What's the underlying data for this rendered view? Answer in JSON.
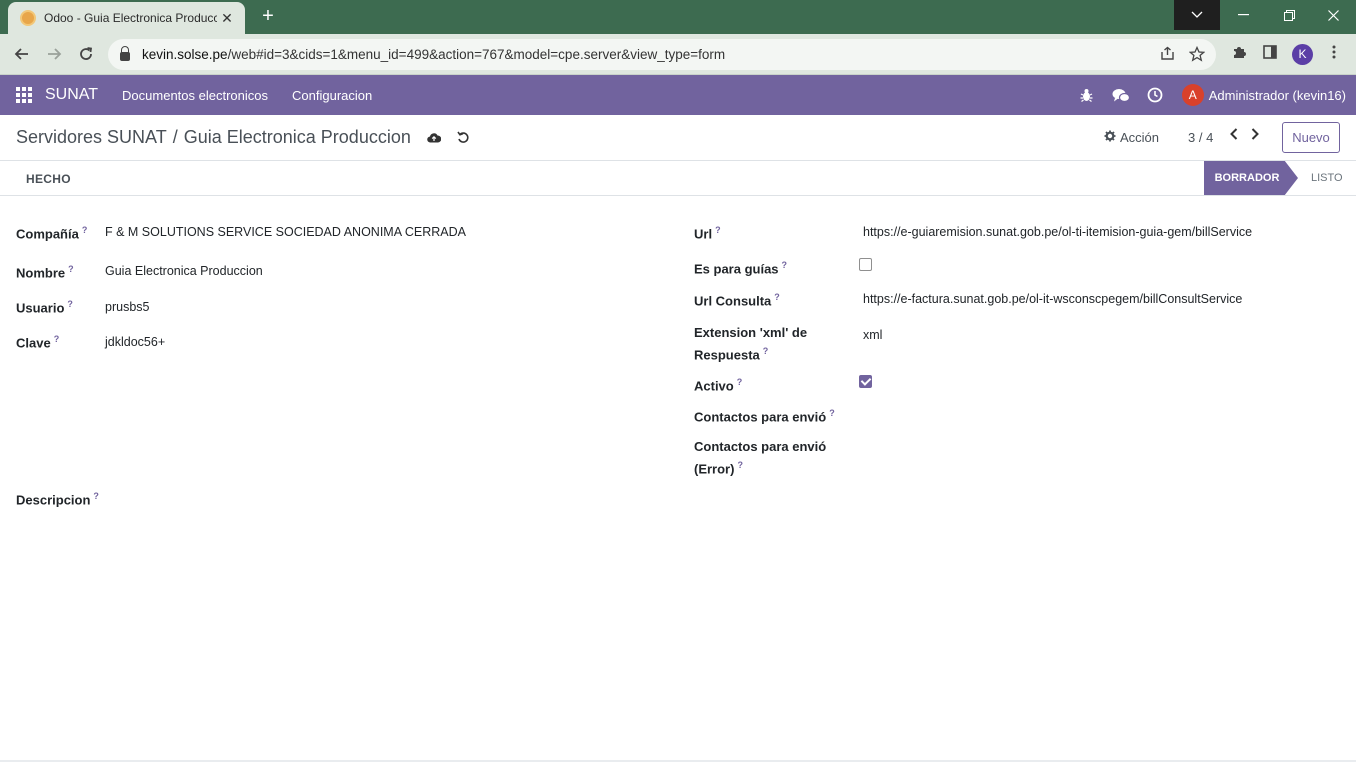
{
  "browser": {
    "tab_title": "Odoo - Guia Electronica Producc",
    "url_host": "kevin.solse.pe",
    "url_path": "/web#id=3&cids=1&menu_id=499&action=767&model=cpe.server&view_type=form",
    "profile_initial": "K"
  },
  "navbar": {
    "brand": "SUNAT",
    "menu": [
      "Documentos electronicos",
      "Configuracion"
    ],
    "avatar_initial": "A",
    "user_name": "Administrador (kevin16)"
  },
  "control_panel": {
    "breadcrumb_parent": "Servidores SUNAT",
    "breadcrumb_sep": "/",
    "breadcrumb_current": "Guia Electronica Produccion",
    "action_label": "Acción",
    "pager": "3 / 4",
    "new_label": "Nuevo"
  },
  "statusbar": {
    "button_label": "HECHO",
    "stages": [
      "BORRADOR",
      "LISTO"
    ],
    "active_stage": "BORRADOR"
  },
  "form": {
    "help_mark": "?",
    "left": {
      "compania": {
        "label": "Compañía",
        "value": "F & M SOLUTIONS SERVICE SOCIEDAD ANONIMA CERRADA"
      },
      "nombre": {
        "label": "Nombre",
        "value": "Guia Electronica Produccion"
      },
      "usuario": {
        "label": "Usuario",
        "value": "prusbs5"
      },
      "clave": {
        "label": "Clave",
        "value": "jdkldoc56+"
      }
    },
    "right": {
      "url": {
        "label": "Url",
        "value": "https://e-guiaremision.sunat.gob.pe/ol-ti-itemision-guia-gem/billService"
      },
      "es_para_guias": {
        "label": "Es para guías",
        "checked": false
      },
      "url_consulta": {
        "label": "Url Consulta",
        "value": "https://e-factura.sunat.gob.pe/ol-it-wsconscpegem/billConsultService"
      },
      "extension_line1": "Extension 'xml' de",
      "extension_line2": "Respuesta",
      "extension_value": "xml",
      "activo": {
        "label": "Activo",
        "checked": true
      },
      "contactos": {
        "label": "Contactos para envió"
      },
      "contactos_error_line1": "Contactos para envió",
      "contactos_error_line2": "(Error)"
    },
    "descripcion": {
      "label": "Descripcion"
    }
  },
  "colors": {
    "brand": "#71639e",
    "avatar": "#d9412b",
    "chrome_frame": "#3d6b50"
  }
}
